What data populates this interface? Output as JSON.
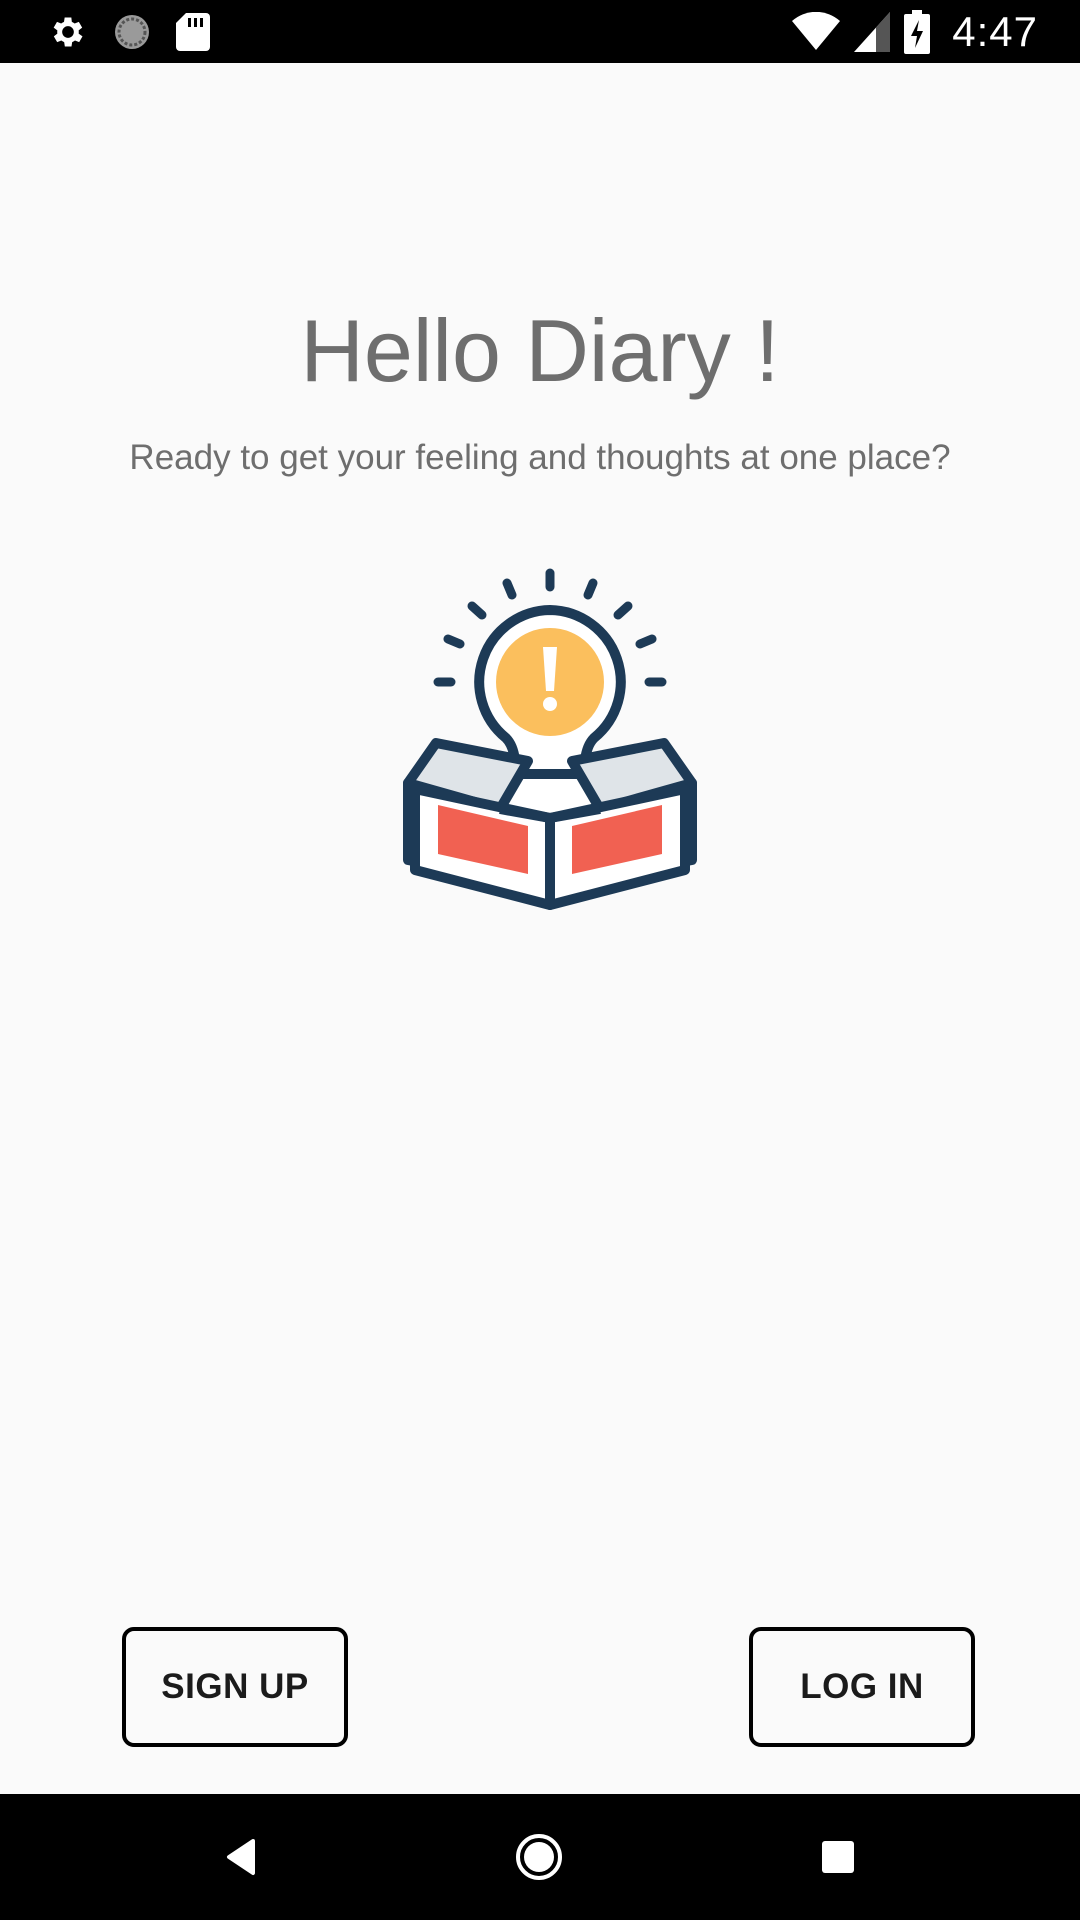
{
  "status_bar": {
    "time": "4:47",
    "left_icons": [
      "settings-icon",
      "sync-icon",
      "sd-card-icon"
    ],
    "right_icons": [
      "wifi-icon",
      "cell-signal-icon",
      "battery-charging-icon"
    ]
  },
  "main": {
    "title": "Hello Diary !",
    "subtitle": "Ready to get your feeling and thoughts at one place?",
    "illustration": "idea-box-illustration"
  },
  "actions": {
    "signup_label": "SIGN UP",
    "login_label": "LOG IN"
  },
  "nav_bar": {
    "buttons": [
      "back-icon",
      "home-icon",
      "recents-icon"
    ]
  },
  "colors": {
    "background": "#fafafa",
    "text_gray": "#6e6e6e",
    "illustration_navy": "#1d3a56",
    "illustration_orange": "#fbbf5d",
    "illustration_red": "#f16152",
    "illustration_light": "#dfe4e8"
  }
}
